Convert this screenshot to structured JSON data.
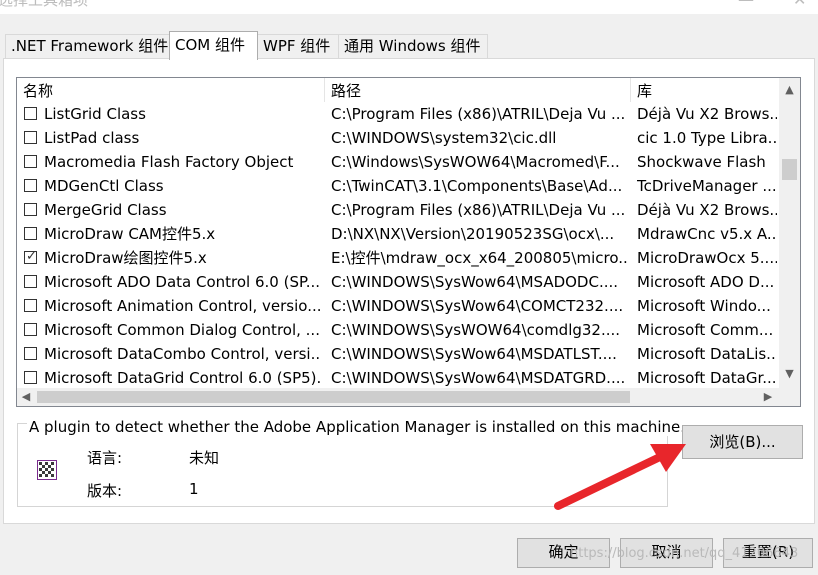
{
  "window": {
    "title": "选择工具箱项",
    "close_glyph": "✕"
  },
  "tabs": [
    {
      "label": ".NET Framework 组件"
    },
    {
      "label": "COM 组件"
    },
    {
      "label": "WPF 组件"
    },
    {
      "label": "通用 Windows 组件"
    }
  ],
  "active_tab": "COM 组件",
  "list": {
    "headers": {
      "name": "名称",
      "path": "路径",
      "library": "库"
    },
    "rows": [
      {
        "checked": false,
        "name": "ListGrid Class",
        "path": "C:\\Program Files (x86)\\ATRIL\\Deja Vu ...",
        "library": "Déjà Vu X2 Brows..."
      },
      {
        "checked": false,
        "name": "ListPad class",
        "path": "C:\\WINDOWS\\system32\\cic.dll",
        "library": "cic 1.0 Type Libra..."
      },
      {
        "checked": false,
        "name": "Macromedia Flash Factory Object",
        "path": "C:\\Windows\\SysWOW64\\Macromed\\F...",
        "library": "Shockwave Flash"
      },
      {
        "checked": false,
        "name": "MDGenCtl Class",
        "path": "C:\\TwinCAT\\3.1\\Components\\Base\\Ad...",
        "library": "TcDriveManager ..."
      },
      {
        "checked": false,
        "name": "MergeGrid Class",
        "path": "C:\\Program Files (x86)\\ATRIL\\Deja Vu ...",
        "library": "Déjà Vu X2 Brows..."
      },
      {
        "checked": false,
        "name": "MicroDraw CAM控件5.x",
        "path": "D:\\NX\\NX\\Version\\20190523SG\\ocx\\...",
        "library": "MdrawCnc v5.x A..."
      },
      {
        "checked": true,
        "name": "MicroDraw绘图控件5.x",
        "path": "E:\\控件\\mdraw_ocx_x64_200805\\micro...",
        "library": "MicroDrawOcx 5...."
      },
      {
        "checked": false,
        "name": "Microsoft ADO Data Control 6.0 (SP...",
        "path": "C:\\WINDOWS\\SysWow64\\MSADODC....",
        "library": "Microsoft ADO D..."
      },
      {
        "checked": false,
        "name": "Microsoft Animation Control, versio...",
        "path": "C:\\WINDOWS\\SysWow64\\COMCT232....",
        "library": "Microsoft Windo..."
      },
      {
        "checked": false,
        "name": "Microsoft Common Dialog Control, ...",
        "path": "C:\\WINDOWS\\SysWOW64\\comdlg32....",
        "library": "Microsoft Comm..."
      },
      {
        "checked": false,
        "name": "Microsoft DataCombo Control, versi...",
        "path": "C:\\WINDOWS\\SysWow64\\MSDATLST....",
        "library": "Microsoft DataLis..."
      },
      {
        "checked": false,
        "name": "Microsoft DataGrid Control 6.0 (SP5)...",
        "path": "C:\\WINDOWS\\SysWow64\\MSDATGRD....",
        "library": "Microsoft DataGr..."
      }
    ]
  },
  "details": {
    "description": "A plugin to detect whether the Adobe Application Manager is installed on this machine.",
    "language_label": "语言:",
    "language_value": "未知",
    "version_label": "版本:",
    "version_value": "1"
  },
  "buttons": {
    "browse": "浏览(B)...",
    "ok": "确定",
    "cancel": "取消",
    "reset": "重置(R)"
  },
  "watermark": "https://blog.csdn.net/qq_41206643",
  "colors": {
    "annotation_arrow": "#e8262b",
    "tab_active_bg": "#ffffff"
  },
  "icons": {
    "checkbox_check": "✓",
    "scroll_up": "▲",
    "scroll_down": "▼",
    "scroll_left": "◀",
    "scroll_right": "▶"
  }
}
